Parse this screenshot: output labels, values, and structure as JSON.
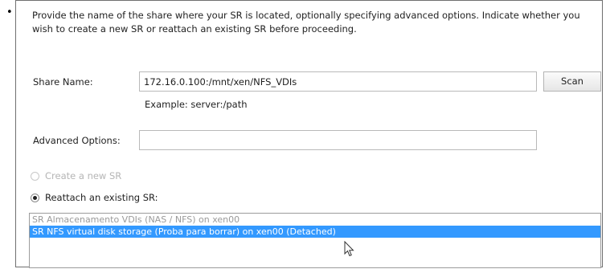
{
  "intro_text": "Provide the name of the share where your SR is located, optionally specifying advanced options. Indicate whether you wish to create a new SR or reattach an existing SR before proceeding.",
  "share_name": {
    "label": "Share Name:",
    "value": "172.16.0.100:/mnt/xen/NFS_VDIs",
    "example": "Example: server:/path"
  },
  "scan_button": "Scan",
  "advanced_options": {
    "label": "Advanced Options:",
    "value": ""
  },
  "radio_create": {
    "label": "Create a new SR",
    "checked": false,
    "enabled": false
  },
  "radio_reattach": {
    "label": "Reattach an existing SR:",
    "checked": true,
    "enabled": true
  },
  "sr_list": [
    {
      "text": "SR Almacenamento VDIs (NAS / NFS) on xen00",
      "selected": false
    },
    {
      "text": "SR NFS virtual disk storage (Proba para borrar) on xen00 (Detached)",
      "selected": true
    }
  ],
  "icons": {
    "cursor": "mouse-pointer-icon"
  }
}
